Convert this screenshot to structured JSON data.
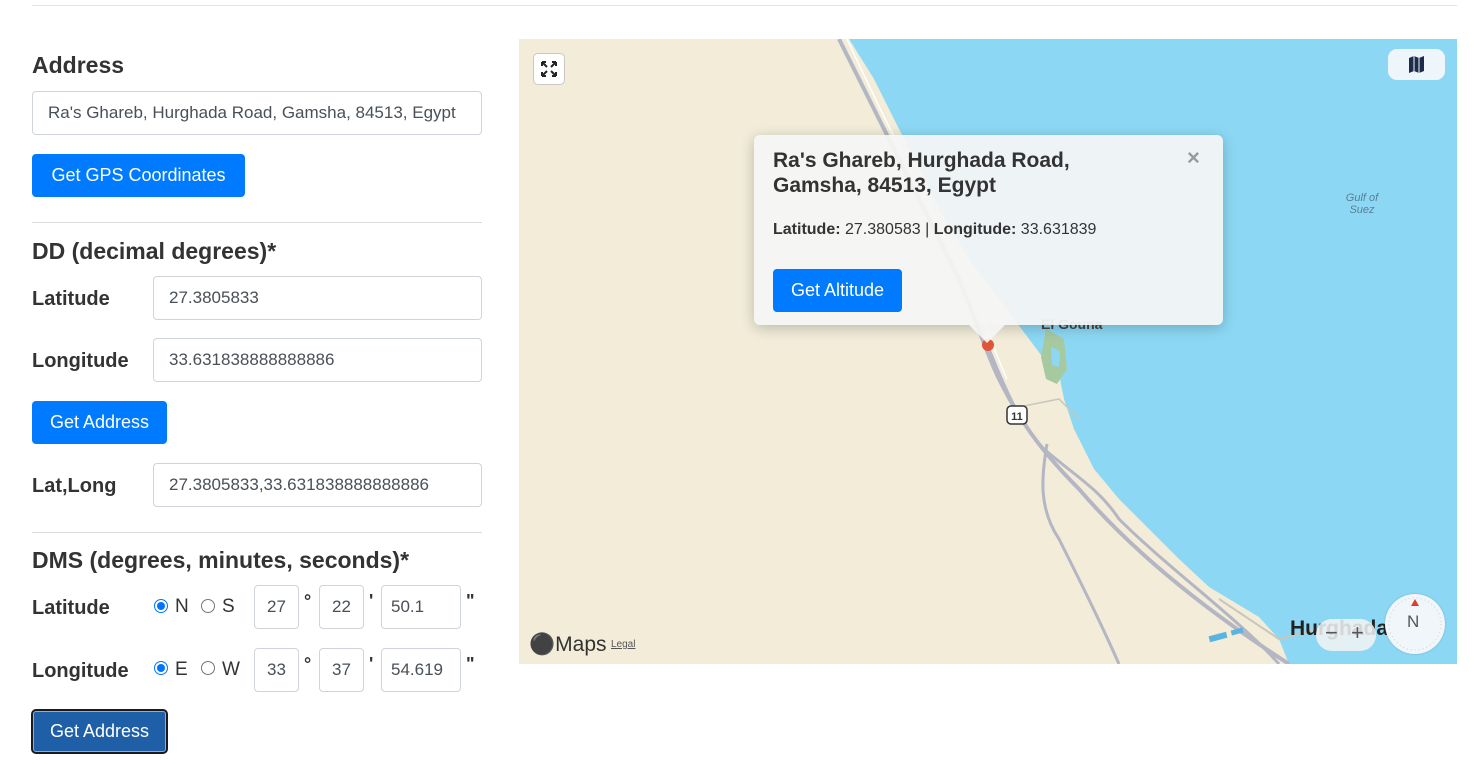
{
  "address_section": {
    "heading": "Address",
    "address_value": "Ra's Ghareb, Hurghada Road, Gamsha, 84513, Egypt",
    "get_gps_button": "Get GPS Coordinates"
  },
  "dd_section": {
    "heading": "DD (decimal degrees)*",
    "latitude_label": "Latitude",
    "latitude_value": "27.3805833",
    "longitude_label": "Longitude",
    "longitude_value": "33.631838888888886",
    "get_address_button": "Get Address",
    "latlong_label": "Lat,Long",
    "latlong_value": "27.3805833,33.631838888888886"
  },
  "dms_section": {
    "heading": "DMS (degrees, minutes, seconds)*",
    "latitude": {
      "label": "Latitude",
      "hemisphere_options": [
        "N",
        "S"
      ],
      "selected": "N",
      "degrees": "27",
      "minutes": "22",
      "seconds": "50.1"
    },
    "longitude": {
      "label": "Longitude",
      "hemisphere_options": [
        "E",
        "W"
      ],
      "selected": "E",
      "degrees": "33",
      "minutes": "37",
      "seconds": "54.619"
    },
    "degree_symbol": "°",
    "minute_symbol": "'",
    "second_symbol": "\"",
    "get_address_button": "Get Address"
  },
  "map": {
    "popup": {
      "title": "Ra's Ghareb, Hurghada Road, Gamsha, 84513, Egypt",
      "latitude_label": "Latitude:",
      "latitude_value": "27.380583",
      "separator": "|",
      "longitude_label": "Longitude:",
      "longitude_value": "33.631839",
      "close_symbol": "×",
      "get_altitude_button": "Get Altitude"
    },
    "labels": {
      "gulf": "Gulf of Suez",
      "town": "El Gouna",
      "city": "Hurghada",
      "route_shield": "11",
      "attribution": "Maps",
      "legal": "Legal",
      "compass_north": "N"
    },
    "zoom": {
      "minus": "−",
      "plus": "+"
    },
    "colors": {
      "land": "#f2ecd9",
      "water": "#8cd8f4",
      "roads": "#b4b6c4",
      "marker": "#e0553a"
    }
  }
}
